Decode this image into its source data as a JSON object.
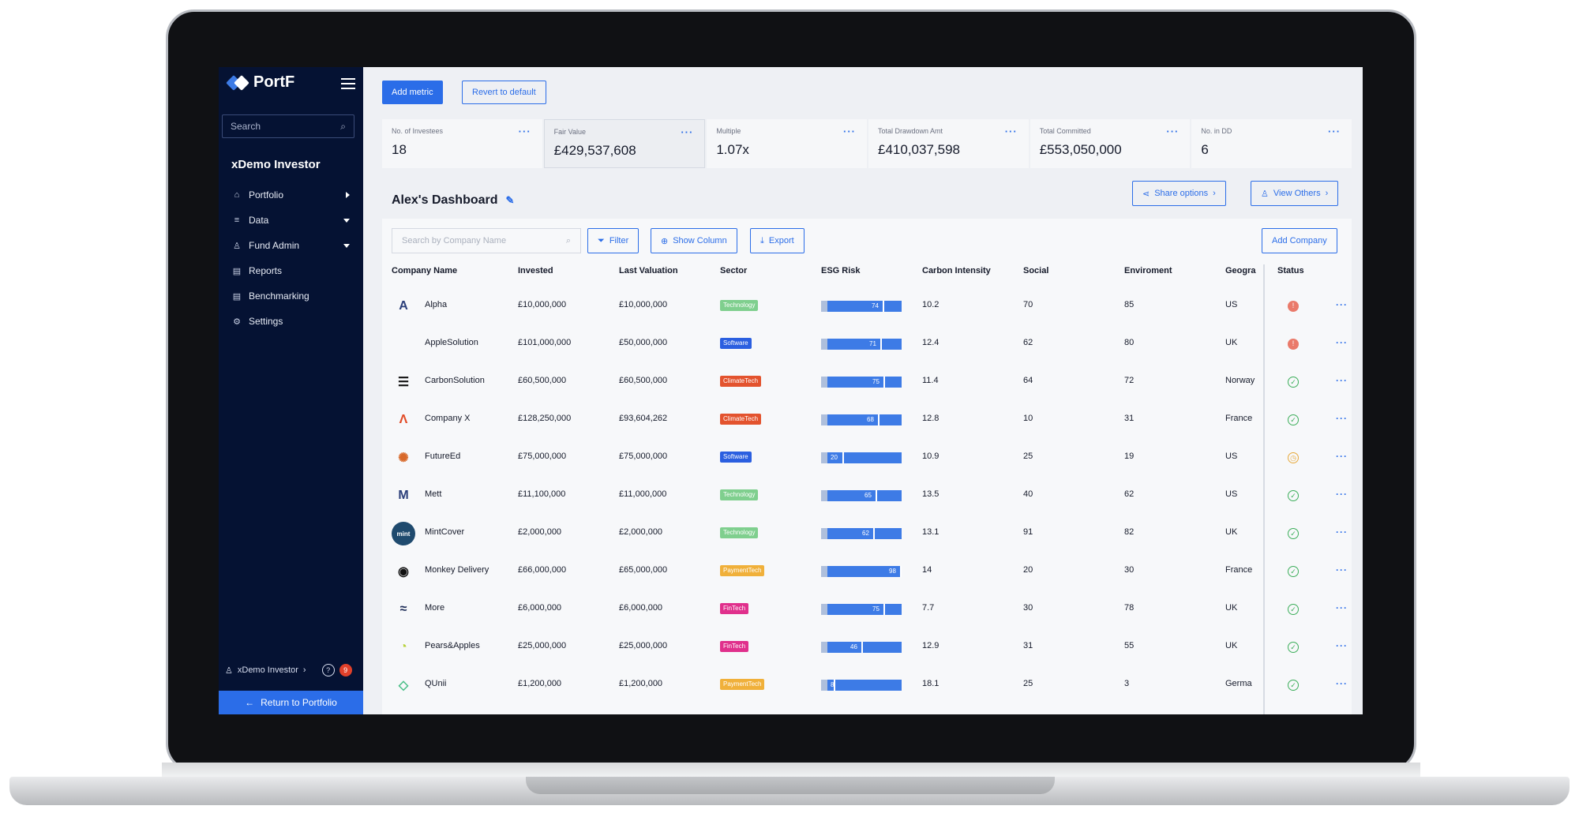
{
  "app": {
    "name": "PortF"
  },
  "sidebar": {
    "search_placeholder": "Search",
    "org_name": "xDemo Investor",
    "items": [
      {
        "label": "Portfolio",
        "icon": "⌂",
        "expander": "right"
      },
      {
        "label": "Data",
        "icon": "≡",
        "expander": "down"
      },
      {
        "label": "Fund Admin",
        "icon": "♙",
        "expander": "down"
      },
      {
        "label": "Reports",
        "icon": "▤",
        "expander": ""
      },
      {
        "label": "Benchmarking",
        "icon": "▤",
        "expander": ""
      },
      {
        "label": "Settings",
        "icon": "⚙",
        "expander": ""
      }
    ],
    "user_label": "xDemo Investor",
    "notification_count": "9",
    "return_label": "Return to Portfolio"
  },
  "toolbar": {
    "add_metric": "Add metric",
    "revert": "Revert to default"
  },
  "metrics": [
    {
      "label": "No. of Investees",
      "value": "18"
    },
    {
      "label": "Fair Value",
      "value": "£429,537,608"
    },
    {
      "label": "Multiple",
      "value": "1.07x"
    },
    {
      "label": "Total Drawdown Amt",
      "value": "£410,037,598"
    },
    {
      "label": "Total Committed",
      "value": "£553,050,000"
    },
    {
      "label": "No. in DD",
      "value": "6"
    }
  ],
  "dashboard": {
    "title": "Alex's Dashboard",
    "share": "Share options",
    "view_others": "View Others"
  },
  "table": {
    "search_placeholder": "Search by Company Name",
    "filter": "Filter",
    "show_column": "Show Column",
    "export": "Export",
    "add_company": "Add Company",
    "columns": [
      "Company Name",
      "Invested",
      "Last Valuation",
      "Sector",
      "ESG Risk",
      "Carbon Intensity",
      "Social",
      "Enviroment",
      "Geogra",
      "Status"
    ],
    "rows": [
      {
        "name": "Alpha",
        "invested": "£10,000,000",
        "valuation": "£10,000,000",
        "sector": "Technology",
        "sector_color": "#7fcf8e",
        "esg": 74,
        "carbon": "10.2",
        "social": "70",
        "env": "85",
        "geo": "US",
        "status": "error",
        "logo": "A",
        "logo_color": "#2b3f7a"
      },
      {
        "name": "AppleSolution",
        "invested": "£101,000,000",
        "valuation": "£50,000,000",
        "sector": "Software",
        "sector_color": "#2b5fe0",
        "esg": 71,
        "carbon": "12.4",
        "social": "62",
        "env": "80",
        "geo": "UK",
        "status": "error",
        "logo": "",
        "logo_color": "#111111"
      },
      {
        "name": "CarbonSolution",
        "invested": "£60,500,000",
        "valuation": "£60,500,000",
        "sector": "ClimateTech",
        "sector_color": "#e3532e",
        "esg": 75,
        "carbon": "11.4",
        "social": "64",
        "env": "72",
        "geo": "Norway",
        "status": "ok",
        "logo": "☰",
        "logo_color": "#111111"
      },
      {
        "name": "Company X",
        "invested": "£128,250,000",
        "valuation": "£93,604,262",
        "sector": "ClimateTech",
        "sector_color": "#e3532e",
        "esg": 68,
        "carbon": "12.8",
        "social": "10",
        "env": "31",
        "geo": "France",
        "status": "ok",
        "logo": "Λ",
        "logo_color": "#e24a25"
      },
      {
        "name": "FutureEd",
        "invested": "£75,000,000",
        "valuation": "£75,000,000",
        "sector": "Software",
        "sector_color": "#2b5fe0",
        "esg": 20,
        "carbon": "10.9",
        "social": "25",
        "env": "19",
        "geo": "US",
        "status": "pending",
        "logo": "✺",
        "logo_color": "#d8692a"
      },
      {
        "name": "Mett",
        "invested": "£11,100,000",
        "valuation": "£11,000,000",
        "sector": "Technology",
        "sector_color": "#7fcf8e",
        "esg": 65,
        "carbon": "13.5",
        "social": "40",
        "env": "62",
        "geo": "US",
        "status": "ok",
        "logo": "M",
        "logo_color": "#2b3f7a"
      },
      {
        "name": "MintCover",
        "invested": "£2,000,000",
        "valuation": "£2,000,000",
        "sector": "Technology",
        "sector_color": "#7fcf8e",
        "esg": 62,
        "carbon": "13.1",
        "social": "91",
        "env": "82",
        "geo": "UK",
        "status": "ok",
        "logo": "mint",
        "logo_color": "#1f4a6e"
      },
      {
        "name": "Monkey Delivery",
        "invested": "£66,000,000",
        "valuation": "£65,000,000",
        "sector": "PaymentTech",
        "sector_color": "#f0b03a",
        "esg": 98,
        "carbon": "14",
        "social": "20",
        "env": "30",
        "geo": "France",
        "status": "ok",
        "logo": "◉",
        "logo_color": "#111111"
      },
      {
        "name": "More",
        "invested": "£6,000,000",
        "valuation": "£6,000,000",
        "sector": "FinTech",
        "sector_color": "#e0308c",
        "esg": 75,
        "carbon": "7.7",
        "social": "30",
        "env": "78",
        "geo": "UK",
        "status": "ok",
        "logo": "≈",
        "logo_color": "#1b2a55"
      },
      {
        "name": "Pears&Apples",
        "invested": "£25,000,000",
        "valuation": "£25,000,000",
        "sector": "FinTech",
        "sector_color": "#e0308c",
        "esg": 46,
        "carbon": "12.9",
        "social": "31",
        "env": "55",
        "geo": "UK",
        "status": "ok",
        "logo": "◔",
        "logo_color": "#b7d23a"
      },
      {
        "name": "QUnii",
        "invested": "£1,200,000",
        "valuation": "£1,200,000",
        "sector": "PaymentTech",
        "sector_color": "#f0b03a",
        "esg": 8,
        "carbon": "18.1",
        "social": "25",
        "env": "3",
        "geo": "Germa",
        "status": "ok",
        "logo": "◇",
        "logo_color": "#4cbf88"
      }
    ]
  }
}
